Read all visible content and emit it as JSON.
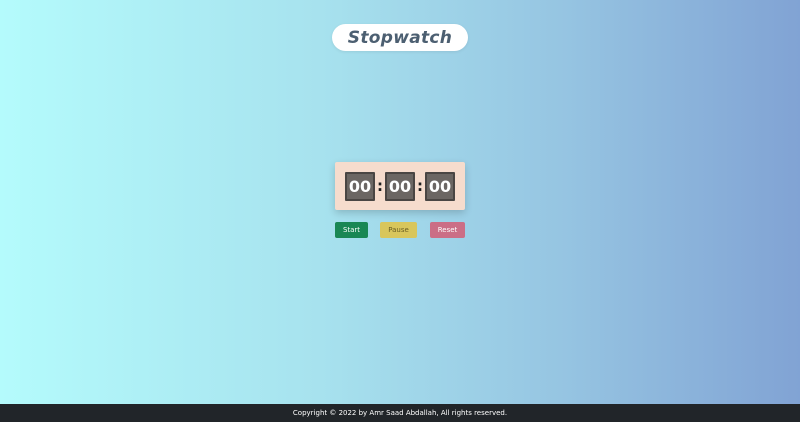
{
  "header": {
    "title": "Stopwatch"
  },
  "stopwatch": {
    "hours": "00",
    "separator_1": ":",
    "minutes": "00",
    "separator_2": ":",
    "seconds": "00"
  },
  "controls": {
    "start_label": "Start",
    "pause_label": "Pause",
    "reset_label": "Reset"
  },
  "footer": {
    "text": "Copyright © 2022 by Amr Saad Abdallah, All rights reserved."
  },
  "colors": {
    "background_start": "#b4fbfc",
    "background_end": "#81a3d4",
    "start_button": "#198754",
    "pause_button": "#d8c65c",
    "reset_button": "#cb6e86",
    "footer": "#212529",
    "clock_panel": "#f6dccd"
  }
}
